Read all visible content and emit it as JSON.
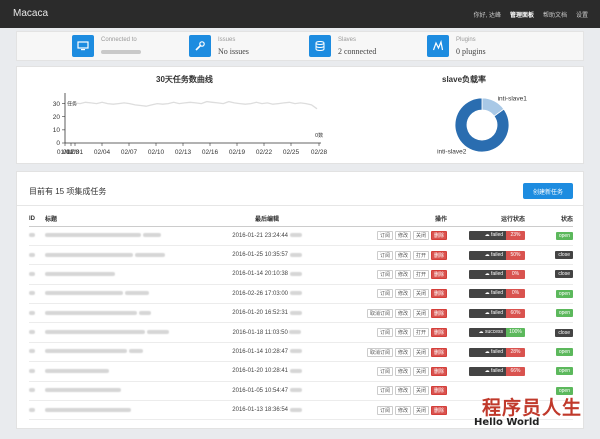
{
  "app": {
    "brand": "Macaca"
  },
  "nav": [
    {
      "label": "你好, 达峰",
      "active": false
    },
    {
      "label": "管理面板",
      "active": true
    },
    {
      "label": "帮助文档",
      "active": false
    },
    {
      "label": "设置",
      "active": false
    }
  ],
  "summary": [
    {
      "label": "Connected to",
      "value": "",
      "icon": "monitor-icon"
    },
    {
      "label": "Issues",
      "value": "No issues",
      "icon": "wrench-icon"
    },
    {
      "label": "Slaves",
      "value": "2 connected",
      "icon": "database-icon"
    },
    {
      "label": "Plugins",
      "value": "0 plugins",
      "icon": "chart-icon"
    }
  ],
  "colors": {
    "accent": "#1d8ce0",
    "danger": "#d9534f",
    "success": "#5cb85c",
    "dark": "#444444",
    "navbar": "#2b2b2b"
  },
  "chart_data": [
    {
      "type": "line",
      "title": "30天任务数曲线",
      "x_ticks": [
        "01/01",
        "01/03",
        "02/01",
        "02/04",
        "02/07",
        "02/10",
        "02/13",
        "02/16",
        "02/19",
        "02/22",
        "02/25",
        "02/28"
      ],
      "y_ticks": [
        0,
        10,
        20,
        30
      ],
      "ylim": [
        0,
        35
      ],
      "series": [
        {
          "values": [
            30,
            30.5,
            30,
            31,
            30.5,
            30,
            31,
            30,
            29.5,
            30,
            30.5,
            30,
            29,
            28.5,
            28,
            29,
            30,
            29.5,
            30,
            31,
            30,
            30.5,
            31,
            30.5,
            30,
            31.5,
            31,
            30.5,
            30,
            31.5,
            30.5,
            30,
            29.5,
            30,
            31,
            30,
            30.5,
            29.5,
            30,
            30.5,
            31,
            30,
            30.5,
            30,
            29,
            26
          ]
        }
      ],
      "annotations": [
        "任务",
        "0数"
      ],
      "color": "#dddddd"
    },
    {
      "type": "pie",
      "title": "slave负载率",
      "slices": [
        {
          "label": "inti-slave1",
          "value": 15,
          "color": "#a8c8e6"
        },
        {
          "label": "inti-slave2",
          "value": 85,
          "color": "#2a6db0"
        }
      ]
    }
  ],
  "tasks": {
    "title": "目前有 15 项集成任务",
    "create_label": "创建新任务",
    "columns": [
      "ID",
      "标题",
      "最后编辑",
      "操作",
      "运行状态",
      "状态"
    ],
    "rows": [
      {
        "time": "2016-01-21 23:24:44",
        "ops": [
          "订阅",
          "修改",
          "关闭",
          "删除"
        ],
        "run": "failed",
        "pct": "23%",
        "pct_color": "#d9534f",
        "status": "open",
        "status_color": "#5cb85c"
      },
      {
        "time": "2016-01-25 10:35:57",
        "ops": [
          "订阅",
          "修改",
          "打开",
          "删除"
        ],
        "run": "failed",
        "pct": "50%",
        "pct_color": "#d9534f",
        "status": "close",
        "status_color": "#444444"
      },
      {
        "time": "2016-01-14 20:10:38",
        "ops": [
          "订阅",
          "修改",
          "打开",
          "删除"
        ],
        "run": "failed",
        "pct": "0%",
        "pct_color": "#d9534f",
        "status": "close",
        "status_color": "#444444"
      },
      {
        "time": "2016-02-26 17:03:00",
        "ops": [
          "订阅",
          "修改",
          "关闭",
          "删除"
        ],
        "run": "failed",
        "pct": "0%",
        "pct_color": "#d9534f",
        "status": "open",
        "status_color": "#5cb85c"
      },
      {
        "time": "2016-01-20 16:52:31",
        "ops": [
          "取消订阅",
          "修改",
          "关闭",
          "删除"
        ],
        "run": "failed",
        "pct": "60%",
        "pct_color": "#d9534f",
        "status": "open",
        "status_color": "#5cb85c"
      },
      {
        "time": "2016-01-18 11:03:50",
        "ops": [
          "订阅",
          "修改",
          "打开",
          "删除"
        ],
        "run": "success",
        "pct": "100%",
        "pct_color": "#5cb85c",
        "status": "close",
        "status_color": "#444444"
      },
      {
        "time": "2016-01-14 10:28:47",
        "ops": [
          "取消订阅",
          "修改",
          "关闭",
          "删除"
        ],
        "run": "failed",
        "pct": "28%",
        "pct_color": "#d9534f",
        "status": "open",
        "status_color": "#5cb85c"
      },
      {
        "time": "2016-01-20 10:28:41",
        "ops": [
          "订阅",
          "修改",
          "关闭",
          "删除"
        ],
        "run": "failed",
        "pct": "66%",
        "pct_color": "#d9534f",
        "status": "open",
        "status_color": "#5cb85c"
      },
      {
        "time": "2016-01-05 10:54:47",
        "ops": [
          "订阅",
          "修改",
          "关闭",
          "删除"
        ],
        "run": "",
        "pct": "",
        "pct_color": "#d9534f",
        "status": "open",
        "status_color": "#5cb85c"
      },
      {
        "time": "2016-01-13 18:36:54",
        "ops": [
          "订阅",
          "修改",
          "关闭",
          "删除"
        ],
        "run": "",
        "pct": "",
        "pct_color": "#d9534f",
        "status": "",
        "status_color": "#5cb85c"
      }
    ]
  },
  "watermark": {
    "line1": "程序员人生",
    "line2": "Hello World"
  }
}
